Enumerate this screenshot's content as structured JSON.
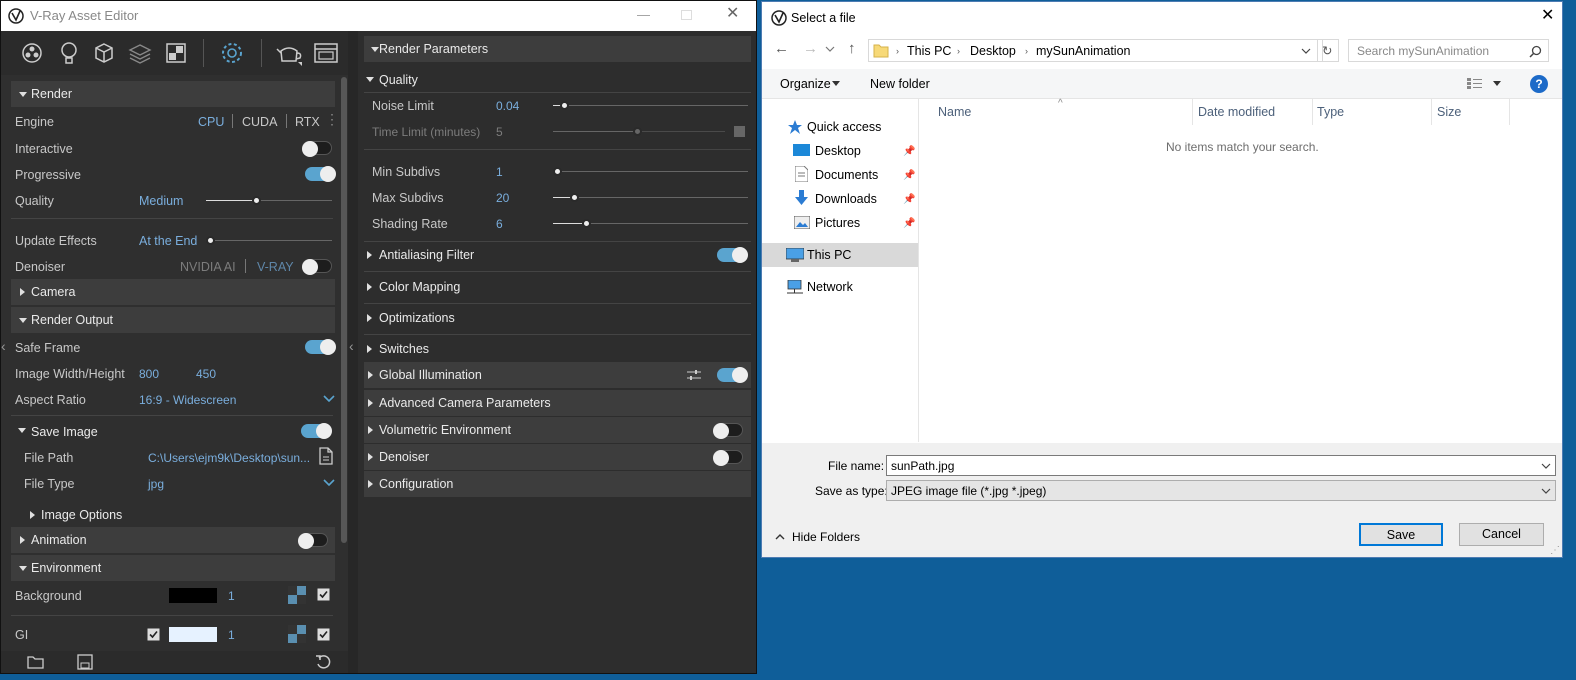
{
  "vray": {
    "title": "V-Ray Asset Editor"
  },
  "left": {
    "render": {
      "title": "Render",
      "engine_label": "Engine",
      "engines": [
        "CPU",
        "CUDA",
        "RTX"
      ],
      "interactive": "Interactive",
      "progressive": "Progressive",
      "quality_label": "Quality",
      "quality_value": "Medium",
      "update_label": "Update Effects",
      "update_value": "At the End",
      "denoiser_label": "Denoiser",
      "denoiser_opts": [
        "NVIDIA AI",
        "V-RAY"
      ]
    },
    "camera": {
      "title": "Camera"
    },
    "output": {
      "title": "Render Output",
      "safe_frame": "Safe Frame",
      "wh_label": "Image Width/Height",
      "width": "800",
      "height": "450",
      "aspect_label": "Aspect Ratio",
      "aspect_value": "16:9 - Widescreen"
    },
    "save": {
      "title": "Save Image",
      "path_label": "File Path",
      "path_value": "C:\\Users\\ejm9k\\Desktop\\sun...",
      "type_label": "File Type",
      "type_value": "jpg",
      "image_options": "Image Options"
    },
    "animation": {
      "title": "Animation"
    },
    "environment": {
      "title": "Environment",
      "bg_label": "Background",
      "bg_value": "1",
      "gi_label": "GI",
      "gi_value": "1"
    }
  },
  "right": {
    "header": "Render Parameters",
    "quality": {
      "title": "Quality",
      "noise_label": "Noise Limit",
      "noise_value": "0.04",
      "time_label": "Time Limit (minutes)",
      "time_value": "5",
      "min_label": "Min Subdivs",
      "min_value": "1",
      "max_label": "Max Subdivs",
      "max_value": "20",
      "shading_label": "Shading Rate",
      "shading_value": "6"
    },
    "sections": [
      "Antialiasing Filter",
      "Color Mapping",
      "Optimizations",
      "Switches",
      "Global Illumination",
      "Advanced Camera Parameters",
      "Volumetric Environment",
      "Denoiser",
      "Configuration"
    ]
  },
  "dialog": {
    "title": "Select a file",
    "path": [
      "This PC",
      "Desktop",
      "mySunAnimation"
    ],
    "search_placeholder": "Search mySunAnimation",
    "organize": "Organize",
    "new_folder": "New folder",
    "help": "?",
    "nav": {
      "quick_access": "Quick access",
      "desktop": "Desktop",
      "documents": "Documents",
      "downloads": "Downloads",
      "pictures": "Pictures",
      "this_pc": "This PC",
      "network": "Network"
    },
    "columns": [
      "Name",
      "Date modified",
      "Type",
      "Size"
    ],
    "empty": "No items match your search.",
    "filename_label": "File name:",
    "filename_value": "sunPath.jpg",
    "savetype_label": "Save as type:",
    "savetype_value": "JPEG image file (*.jpg *.jpeg)",
    "hide_folders": "Hide Folders",
    "save": "Save",
    "cancel": "Cancel"
  },
  "colors": {
    "accent": "#5aa4cf",
    "panel": "#2f2f2f",
    "section": "#3d3d3d",
    "desktop": "#0f5e99"
  }
}
